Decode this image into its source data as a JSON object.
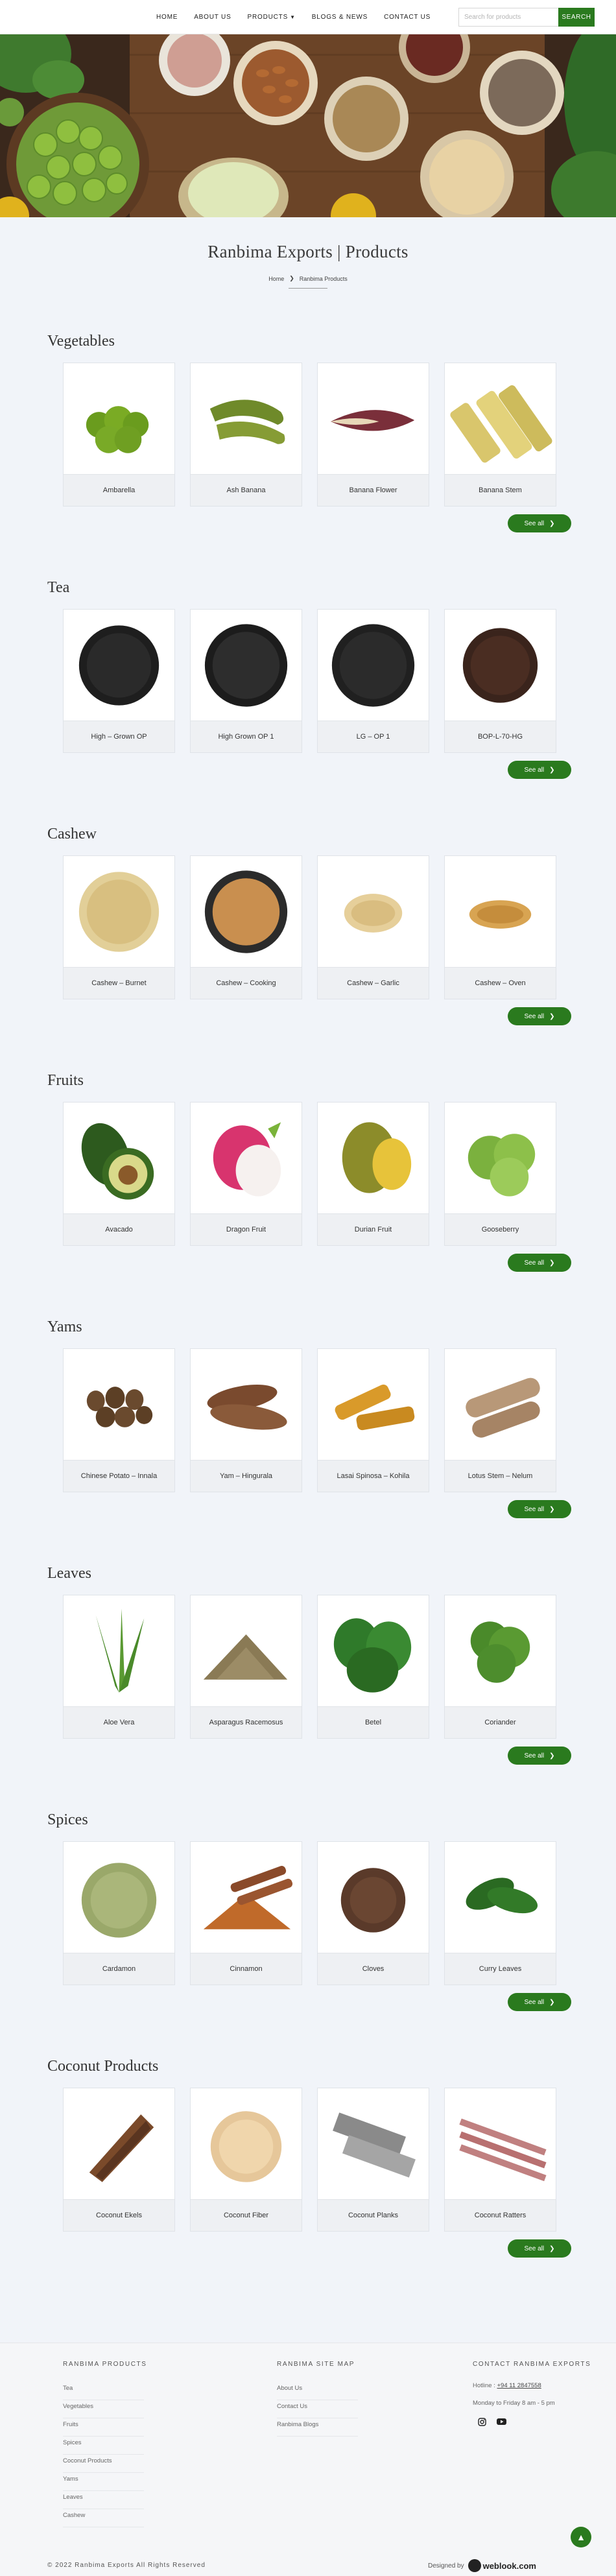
{
  "nav": {
    "links": [
      "HOME",
      "ABOUT US",
      "PRODUCTS",
      "BLOGS & NEWS",
      "CONTACT US"
    ],
    "search_placeholder": "Search for products",
    "search_button": "SEARCH"
  },
  "page_title": "Ranbima Exports | Products",
  "breadcrumb": {
    "home": "Home",
    "current": "Ranbima Products"
  },
  "see_all_label": "See all",
  "categories": [
    {
      "title": "Vegetables",
      "items": [
        "Ambarella",
        "Ash Banana",
        "Banana Flower",
        "Banana Stem"
      ]
    },
    {
      "title": "Tea",
      "items": [
        "High – Grown OP",
        "High Grown OP 1",
        "LG – OP 1",
        "BOP-L-70-HG"
      ]
    },
    {
      "title": "Cashew",
      "items": [
        "Cashew – Burnet",
        "Cashew – Cooking",
        "Cashew – Garlic",
        "Cashew – Oven"
      ]
    },
    {
      "title": "Fruits",
      "items": [
        "Avacado",
        "Dragon Fruit",
        "Durian Fruit",
        "Gooseberry"
      ]
    },
    {
      "title": "Yams",
      "items": [
        "Chinese Potato – Innala",
        "Yam – Hingurala",
        "Lasai Spinosa – Kohila",
        "Lotus Stem – Nelum"
      ]
    },
    {
      "title": "Leaves",
      "items": [
        "Aloe Vera",
        "Asparagus Racemosus",
        "Betel",
        "Coriander"
      ]
    },
    {
      "title": "Spices",
      "items": [
        "Cardamon",
        "Cinnamon",
        "Cloves",
        "Curry Leaves"
      ]
    },
    {
      "title": "Coconut Products",
      "items": [
        "Coconut Ekels",
        "Coconut Fiber",
        "Coconut Planks",
        "Coconut Ratters"
      ]
    }
  ],
  "footer": {
    "products_title": "RANBIMA PRODUCTS",
    "products_links": [
      "Tea",
      "Vegetables",
      "Fruits",
      "Spices",
      "Coconut Products",
      "Yams",
      "Leaves",
      "Cashew"
    ],
    "sitemap_title": "RANBIMA SITE MAP",
    "sitemap_links": [
      "About Us",
      "Contact Us",
      "Ranbima Blogs"
    ],
    "contact_title": "CONTACT RANBIMA EXPORTS",
    "hotline_label": "Hotline :",
    "hotline_number": "+94 11 2847558",
    "hours": "Monday to Friday 8 am - 5 pm",
    "copyright": "© 2022 Ranbima Exports All Rights Reserved",
    "designed_by": "Designed by",
    "designer": "weblook.com"
  },
  "colors": {
    "accent": "#2a7a1e",
    "background": "#f1f4f9"
  }
}
